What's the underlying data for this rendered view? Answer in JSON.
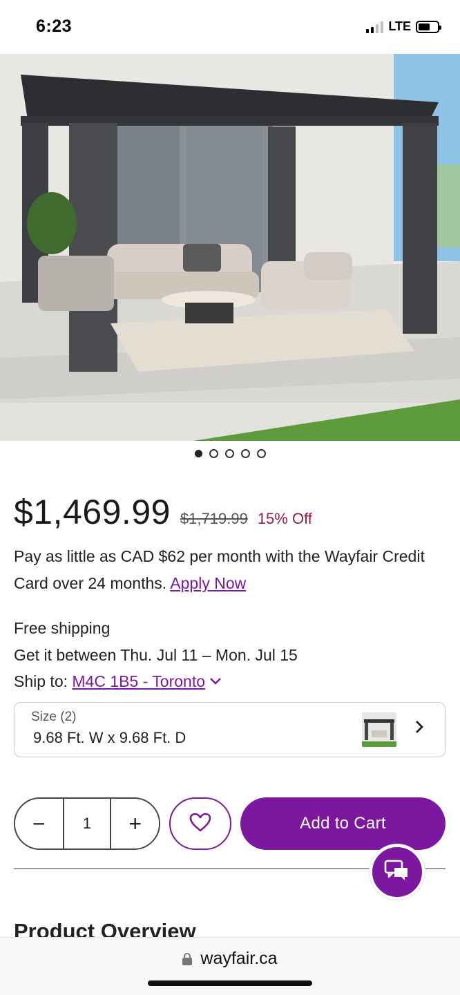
{
  "status_bar": {
    "time": "6:23",
    "network": "LTE",
    "icons": [
      "signal-icon",
      "battery-icon"
    ]
  },
  "gallery": {
    "image_alt": "",
    "slide_count": 5,
    "active_index": 0
  },
  "price": {
    "current": "$1,469.99",
    "original": "$1,719.99",
    "discount": "15% Off"
  },
  "financing": {
    "text": "Pay as little as CAD $62 per month with the Wayfair Credit Card over 24 months.",
    "link_label": "Apply Now"
  },
  "shipping": {
    "free": "Free shipping",
    "delivery": "Get it between Thu. Jul 11 – Mon. Jul 15",
    "ship_to_label": "Ship to:",
    "ship_to_value": "M4C 1B5 - Toronto"
  },
  "size_selector": {
    "label": "Size (2)",
    "value": "9.68 Ft. W x 9.68 Ft. D"
  },
  "quantity": {
    "value": "1",
    "minus": "−",
    "plus": "+"
  },
  "actions": {
    "add_to_cart": "Add to Cart"
  },
  "sections": {
    "overview_title": "Product Overview"
  },
  "browser": {
    "url": "wayfair.ca"
  },
  "colors": {
    "brand_purple": "#7b189f",
    "discount_red": "#9b1c3c"
  }
}
